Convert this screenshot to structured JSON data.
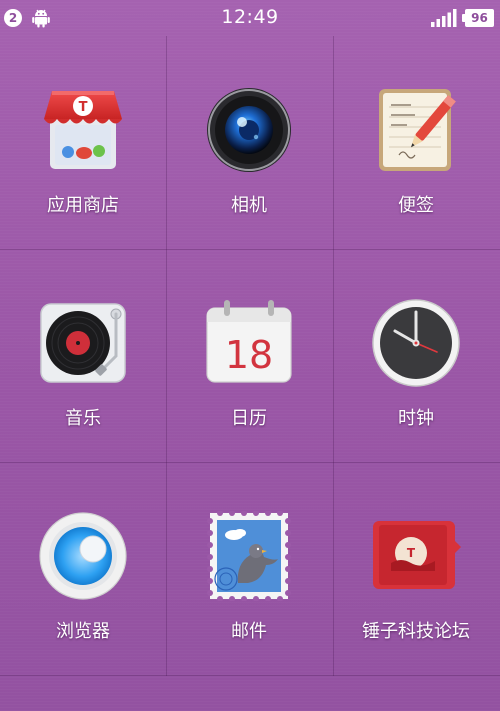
{
  "status_bar": {
    "notification_count": "2",
    "time": "12:49",
    "battery": "96",
    "icons": [
      "android-icon",
      "signal-icon",
      "battery-icon"
    ]
  },
  "apps": [
    {
      "name": "app-store",
      "label": "应用商店",
      "icon": "shop-awning-icon",
      "badge_letter": "T"
    },
    {
      "name": "camera",
      "label": "相机",
      "icon": "camera-lens-icon"
    },
    {
      "name": "notes",
      "label": "便签",
      "icon": "notepad-pencil-icon"
    },
    {
      "name": "music",
      "label": "音乐",
      "icon": "record-player-icon"
    },
    {
      "name": "calendar",
      "label": "日历",
      "icon": "calendar-icon",
      "day": "18"
    },
    {
      "name": "clock",
      "label": "时钟",
      "icon": "clock-icon"
    },
    {
      "name": "browser",
      "label": "浏览器",
      "icon": "browser-icon"
    },
    {
      "name": "mail",
      "label": "邮件",
      "icon": "stamp-pigeon-icon"
    },
    {
      "name": "forum",
      "label": "锤子科技论坛",
      "icon": "forum-icon",
      "badge_letter": "T"
    }
  ],
  "colors": {
    "background": "#9c5aa8",
    "accent_red": "#e03a3a",
    "text": "#ffffff"
  }
}
